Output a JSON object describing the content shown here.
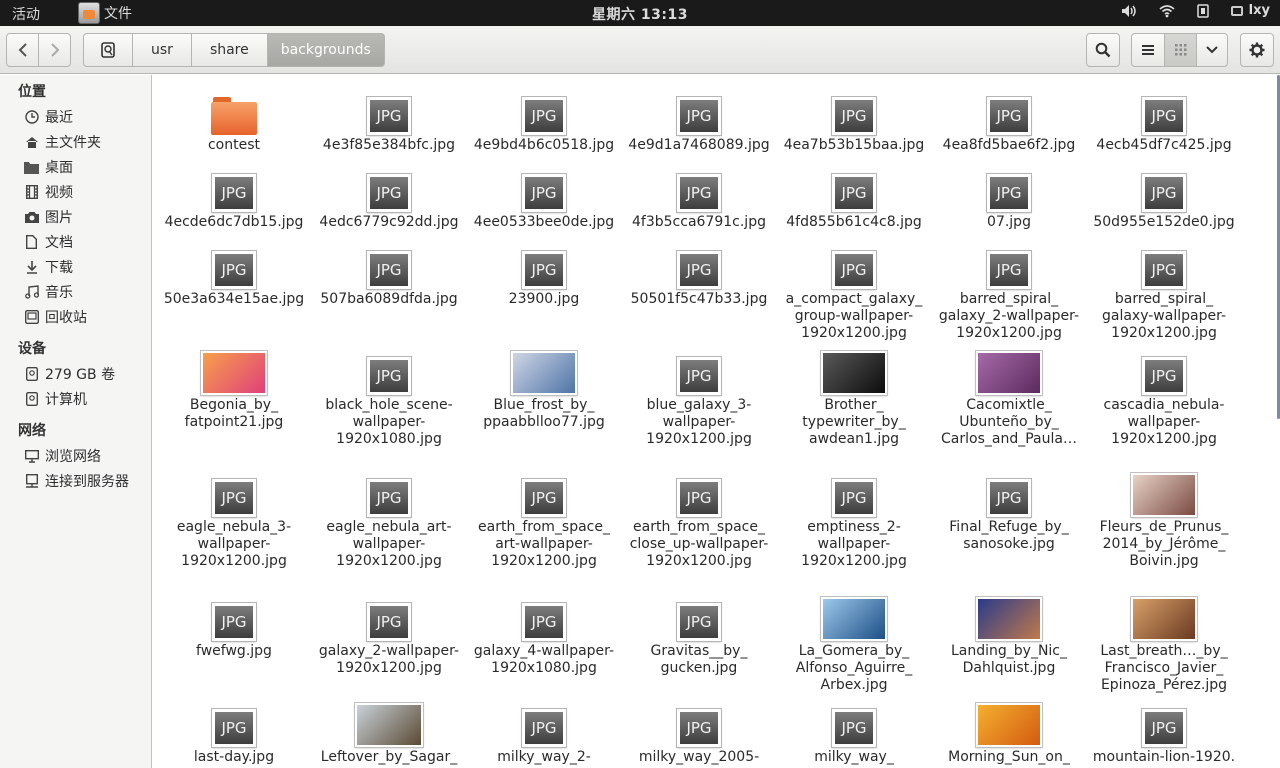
{
  "topbar": {
    "activities": "活动",
    "app_name": "文件",
    "clock": "星期六 13:13",
    "user": "lxy"
  },
  "toolbar": {
    "breadcrumbs": [
      "usr",
      "share",
      "backgrounds"
    ]
  },
  "sidebar": {
    "sections": [
      {
        "title": "位置",
        "items": [
          {
            "label": "最近",
            "icon": "clock-icon"
          },
          {
            "label": "主文件夹",
            "icon": "home-icon"
          },
          {
            "label": "桌面",
            "icon": "desktop-folder-icon"
          },
          {
            "label": "视频",
            "icon": "film-icon"
          },
          {
            "label": "图片",
            "icon": "camera-icon"
          },
          {
            "label": "文档",
            "icon": "document-icon"
          },
          {
            "label": "下载",
            "icon": "download-icon"
          },
          {
            "label": "音乐",
            "icon": "music-icon"
          },
          {
            "label": "回收站",
            "icon": "trash-icon"
          }
        ]
      },
      {
        "title": "设备",
        "items": [
          {
            "label": "279 GB 卷",
            "icon": "drive-icon"
          },
          {
            "label": "计算机",
            "icon": "computer-icon"
          }
        ]
      },
      {
        "title": "网络",
        "items": [
          {
            "label": "浏览网络",
            "icon": "network-icon"
          },
          {
            "label": "连接到服务器",
            "icon": "server-icon"
          }
        ]
      }
    ]
  },
  "files": [
    {
      "lines": [
        "contest"
      ],
      "type": "folder"
    },
    {
      "lines": [
        "4e3f85e384bfc.jpg"
      ],
      "type": "jpg"
    },
    {
      "lines": [
        "4e9bd4b6c0518.jpg"
      ],
      "type": "jpg"
    },
    {
      "lines": [
        "4e9d1a7468089.jpg"
      ],
      "type": "jpg"
    },
    {
      "lines": [
        "4ea7b53b15baa.jpg"
      ],
      "type": "jpg"
    },
    {
      "lines": [
        "4ea8fd5bae6f2.jpg"
      ],
      "type": "jpg"
    },
    {
      "lines": [
        "4ecb45df7c425.jpg"
      ],
      "type": "jpg"
    },
    {
      "lines": [
        "4ecde6dc7db15.jpg"
      ],
      "type": "jpg"
    },
    {
      "lines": [
        "4edc6779c92dd.jpg"
      ],
      "type": "jpg"
    },
    {
      "lines": [
        "4ee0533bee0de.jpg"
      ],
      "type": "jpg"
    },
    {
      "lines": [
        "4f3b5cca6791c.jpg"
      ],
      "type": "jpg"
    },
    {
      "lines": [
        "4fd855b61c4c8.jpg"
      ],
      "type": "jpg"
    },
    {
      "lines": [
        "07.jpg"
      ],
      "type": "jpg"
    },
    {
      "lines": [
        "50d955e152de0.jpg"
      ],
      "type": "jpg"
    },
    {
      "lines": [
        "50e3a634e15ae.jpg"
      ],
      "type": "jpg"
    },
    {
      "lines": [
        "507ba6089dfda.jpg"
      ],
      "type": "jpg"
    },
    {
      "lines": [
        "23900.jpg"
      ],
      "type": "jpg"
    },
    {
      "lines": [
        "50501f5c47b33.jpg"
      ],
      "type": "jpg"
    },
    {
      "lines": [
        "a_compact_galaxy_",
        "group-wallpaper-",
        "1920x1200.jpg"
      ],
      "type": "jpg"
    },
    {
      "lines": [
        "barred_spiral_",
        "galaxy_2-wallpaper-",
        "1920x1200.jpg"
      ],
      "type": "jpg"
    },
    {
      "lines": [
        "barred_spiral_",
        "galaxy-wallpaper-",
        "1920x1200.jpg"
      ],
      "type": "jpg"
    },
    {
      "lines": [
        "Begonia_by_",
        "fatpoint21.jpg"
      ],
      "type": "photo",
      "colors": [
        "#f7a04a",
        "#e0407a"
      ]
    },
    {
      "lines": [
        "black_hole_scene-",
        "wallpaper-",
        "1920x1080.jpg"
      ],
      "type": "jpg"
    },
    {
      "lines": [
        "Blue_frost_by_",
        "ppaabblloo77.jpg"
      ],
      "type": "photo",
      "colors": [
        "#cfd6e4",
        "#4f74a8"
      ]
    },
    {
      "lines": [
        "blue_galaxy_3-",
        "wallpaper-",
        "1920x1200.jpg"
      ],
      "type": "jpg"
    },
    {
      "lines": [
        "Brother_",
        "typewriter_by_",
        "awdean1.jpg"
      ],
      "type": "photo",
      "colors": [
        "#5a5a5a",
        "#0c0c0c"
      ]
    },
    {
      "lines": [
        "Cacomixtle_",
        "Ubunteño_by_",
        "Carlos_and_Paula…"
      ],
      "type": "photo",
      "colors": [
        "#a56aa8",
        "#5c2a5e"
      ]
    },
    {
      "lines": [
        "cascadia_nebula-",
        "wallpaper-",
        "1920x1200.jpg"
      ],
      "type": "jpg"
    },
    {
      "lines": [
        "eagle_nebula_3-",
        "wallpaper-",
        "1920x1200.jpg"
      ],
      "type": "jpg"
    },
    {
      "lines": [
        "eagle_nebula_art-",
        "wallpaper-",
        "1920x1200.jpg"
      ],
      "type": "jpg"
    },
    {
      "lines": [
        "earth_from_space_",
        "art-wallpaper-",
        "1920x1200.jpg"
      ],
      "type": "jpg"
    },
    {
      "lines": [
        "earth_from_space_",
        "close_up-wallpaper-",
        "1920x1200.jpg"
      ],
      "type": "jpg"
    },
    {
      "lines": [
        "emptiness_2-",
        "wallpaper-",
        "1920x1200.jpg"
      ],
      "type": "jpg"
    },
    {
      "lines": [
        "Final_Refuge_by_",
        "sanosoke.jpg"
      ],
      "type": "jpg"
    },
    {
      "lines": [
        "Fleurs_de_Prunus_",
        "2014_by_Jérôme_",
        "Boivin.jpg"
      ],
      "type": "photo",
      "colors": [
        "#e8d2c6",
        "#7a4a42"
      ]
    },
    {
      "lines": [
        "fwefwg.jpg"
      ],
      "type": "jpg"
    },
    {
      "lines": [
        "galaxy_2-wallpaper-",
        "1920x1200.jpg"
      ],
      "type": "jpg"
    },
    {
      "lines": [
        "galaxy_4-wallpaper-",
        "1920x1080.jpg"
      ],
      "type": "jpg"
    },
    {
      "lines": [
        "Gravitas__by_",
        "gucken.jpg"
      ],
      "type": "jpg"
    },
    {
      "lines": [
        "La_Gomera_by_",
        "Alfonso_Aguirre_",
        "Arbex.jpg"
      ],
      "type": "photo",
      "colors": [
        "#9cc8ea",
        "#1d4f86"
      ]
    },
    {
      "lines": [
        "Landing_by_Nic_",
        "Dahlquist.jpg"
      ],
      "type": "photo",
      "colors": [
        "#2a3a8a",
        "#c07a4a"
      ]
    },
    {
      "lines": [
        "Last_breath…_by_",
        "Francisco_Javier_",
        "Epinoza_Pérez.jpg"
      ],
      "type": "photo",
      "colors": [
        "#d8a068",
        "#6a3a22"
      ]
    },
    {
      "lines": [
        "last-day.jpg"
      ],
      "type": "jpg"
    },
    {
      "lines": [
        "Leftover_by_Sagar_"
      ],
      "type": "photo",
      "colors": [
        "#c9d2da",
        "#5a4a32"
      ]
    },
    {
      "lines": [
        "milky_way_2-"
      ],
      "type": "jpg"
    },
    {
      "lines": [
        "milky_way_2005-"
      ],
      "type": "jpg"
    },
    {
      "lines": [
        "milky_way_"
      ],
      "type": "jpg"
    },
    {
      "lines": [
        "Morning_Sun_on_"
      ],
      "type": "photo",
      "colors": [
        "#f4b030",
        "#d45a10"
      ]
    },
    {
      "lines": [
        "mountain-lion-1920."
      ],
      "type": "jpg"
    }
  ],
  "jpg_badge": "JPG"
}
